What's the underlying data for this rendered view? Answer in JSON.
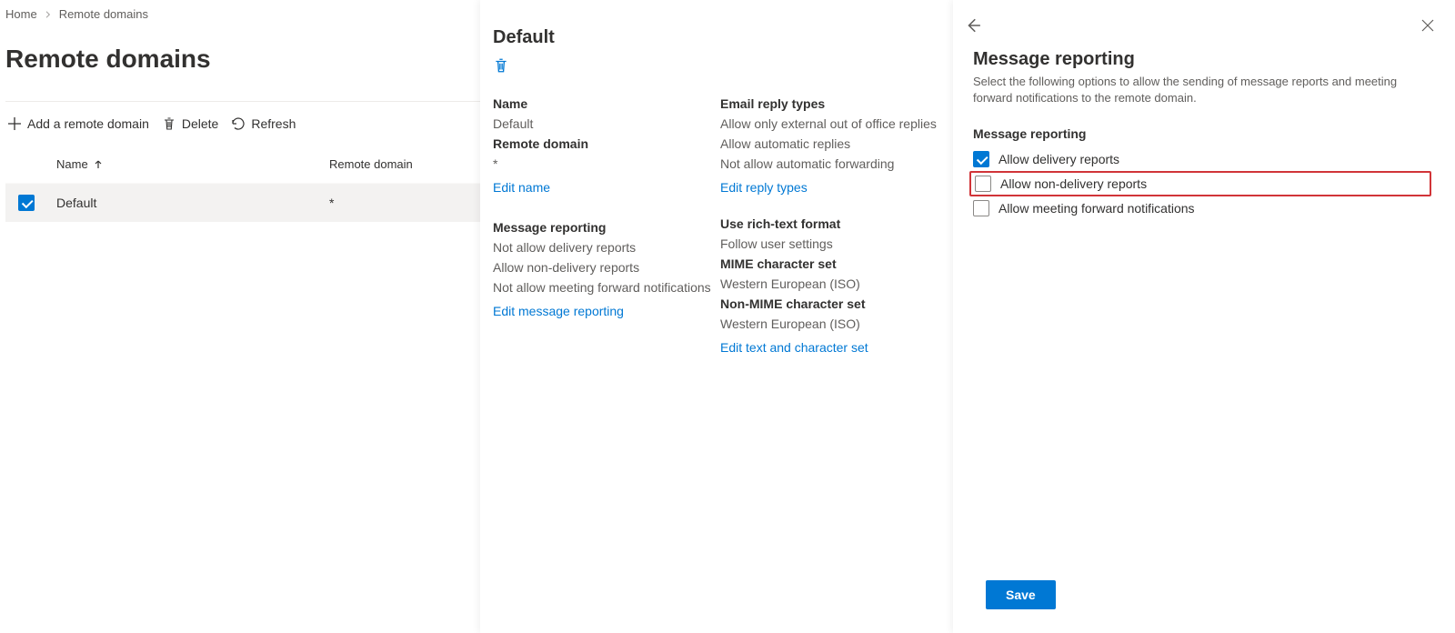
{
  "breadcrumb": {
    "home": "Home",
    "current": "Remote domains"
  },
  "page_title": "Remote domains",
  "toolbar": {
    "add": "Add a remote domain",
    "delete": "Delete",
    "refresh": "Refresh"
  },
  "table": {
    "col_name": "Name",
    "col_domain": "Remote domain",
    "row": {
      "name": "Default",
      "domain": "*"
    }
  },
  "details": {
    "title": "Default",
    "name_label": "Name",
    "name_value": "Default",
    "domain_label": "Remote domain",
    "domain_value": "*",
    "edit_name": "Edit name",
    "msgrep_label": "Message reporting",
    "msgrep_v1": "Not allow delivery reports",
    "msgrep_v2": "Allow non-delivery reports",
    "msgrep_v3": "Not allow meeting forward notifications",
    "edit_msgrep": "Edit message reporting",
    "reply_label": "Email reply types",
    "reply_v1": "Allow only external out of office replies",
    "reply_v2": "Allow automatic replies",
    "reply_v3": "Not allow automatic forwarding",
    "edit_reply": "Edit reply types",
    "rich_label": "Use rich-text format",
    "rich_value": "Follow user settings",
    "mime_label": "MIME character set",
    "mime_value": "Western European (ISO)",
    "nonmime_label": "Non-MIME character set",
    "nonmime_value": "Western European (ISO)",
    "edit_text": "Edit text and character set"
  },
  "form": {
    "title": "Message reporting",
    "desc": "Select the following options to allow the sending of message reports and meeting forward notifications to the remote domain.",
    "section": "Message reporting",
    "cb_delivery": "Allow delivery reports",
    "cb_nondelivery": "Allow non-delivery reports",
    "cb_meeting": "Allow meeting forward notifications",
    "save": "Save"
  }
}
